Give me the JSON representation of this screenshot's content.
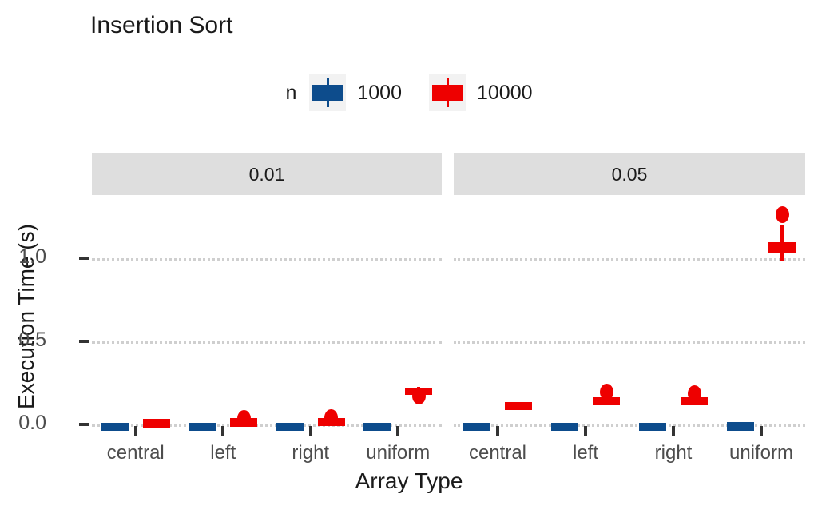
{
  "chart_data": {
    "type": "box",
    "title": "Insertion Sort",
    "xlabel": "Array Type",
    "ylabel": "Execution Time (s)",
    "ylim": [
      -0.06,
      1.38
    ],
    "yticks": [
      0.0,
      0.5,
      1.0
    ],
    "ytick_labels": [
      "0.0",
      "0.5",
      "1.0"
    ],
    "grid": "horizontal-dotted",
    "legend_title": "n",
    "legend_position": "top",
    "legend": [
      {
        "label": "1000",
        "color": "#0d4c8c"
      },
      {
        "label": "10000",
        "color": "#ee0000"
      }
    ],
    "facet_var": "threshold",
    "facets": [
      "0.01",
      "0.05"
    ],
    "categories": [
      "central",
      "left",
      "right",
      "uniform"
    ],
    "series": [
      {
        "name": "1000",
        "color": "#0d4c8c",
        "boxes": [
          {
            "facet": "0.01",
            "category": "central",
            "lower_whisker": 0.0,
            "q1": 0.001,
            "median": 0.002,
            "q3": 0.004,
            "upper_whisker": 0.005,
            "outliers": []
          },
          {
            "facet": "0.01",
            "category": "left",
            "lower_whisker": 0.0,
            "q1": 0.001,
            "median": 0.002,
            "q3": 0.004,
            "upper_whisker": 0.005,
            "outliers": []
          },
          {
            "facet": "0.01",
            "category": "right",
            "lower_whisker": 0.0,
            "q1": 0.001,
            "median": 0.002,
            "q3": 0.004,
            "upper_whisker": 0.005,
            "outliers": []
          },
          {
            "facet": "0.01",
            "category": "uniform",
            "lower_whisker": 0.0,
            "q1": 0.001,
            "median": 0.002,
            "q3": 0.004,
            "upper_whisker": 0.005,
            "outliers": []
          },
          {
            "facet": "0.05",
            "category": "central",
            "lower_whisker": 0.0,
            "q1": 0.001,
            "median": 0.002,
            "q3": 0.003,
            "upper_whisker": 0.004,
            "outliers": []
          },
          {
            "facet": "0.05",
            "category": "left",
            "lower_whisker": 0.0,
            "q1": 0.001,
            "median": 0.002,
            "q3": 0.003,
            "upper_whisker": 0.004,
            "outliers": []
          },
          {
            "facet": "0.05",
            "category": "right",
            "lower_whisker": 0.0,
            "q1": 0.001,
            "median": 0.002,
            "q3": 0.004,
            "upper_whisker": 0.005,
            "outliers": []
          },
          {
            "facet": "0.05",
            "category": "uniform",
            "lower_whisker": 0.0,
            "q1": 0.002,
            "median": 0.004,
            "q3": 0.006,
            "upper_whisker": 0.008,
            "outliers": []
          }
        ]
      },
      {
        "name": "10000",
        "color": "#ee0000",
        "boxes": [
          {
            "facet": "0.01",
            "category": "central",
            "lower_whisker": 0.018,
            "q1": 0.021,
            "median": 0.023,
            "q3": 0.025,
            "upper_whisker": 0.028,
            "outliers": []
          },
          {
            "facet": "0.01",
            "category": "left",
            "lower_whisker": 0.02,
            "q1": 0.024,
            "median": 0.027,
            "q3": 0.03,
            "upper_whisker": 0.033,
            "outliers": [
              0.038
            ]
          },
          {
            "facet": "0.01",
            "category": "right",
            "lower_whisker": 0.022,
            "q1": 0.026,
            "median": 0.03,
            "q3": 0.034,
            "upper_whisker": 0.038,
            "outliers": [
              0.043
            ]
          },
          {
            "facet": "0.01",
            "category": "uniform",
            "lower_whisker": 0.2,
            "q1": 0.207,
            "median": 0.213,
            "q3": 0.219,
            "upper_whisker": 0.228,
            "outliers": [
              0.175
            ]
          },
          {
            "facet": "0.05",
            "category": "central",
            "lower_whisker": 0.118,
            "q1": 0.122,
            "median": 0.125,
            "q3": 0.128,
            "upper_whisker": 0.132,
            "outliers": []
          },
          {
            "facet": "0.05",
            "category": "left",
            "lower_whisker": 0.144,
            "q1": 0.15,
            "median": 0.155,
            "q3": 0.16,
            "upper_whisker": 0.166,
            "outliers": [
              0.197
            ]
          },
          {
            "facet": "0.05",
            "category": "right",
            "lower_whisker": 0.142,
            "q1": 0.148,
            "median": 0.153,
            "q3": 0.158,
            "upper_whisker": 0.164,
            "outliers": [
              0.186
            ]
          },
          {
            "facet": "0.05",
            "category": "uniform",
            "lower_whisker": 0.985,
            "q1": 1.03,
            "median": 1.062,
            "q3": 1.098,
            "upper_whisker": 1.195,
            "outliers": [
              1.265
            ]
          }
        ]
      }
    ]
  }
}
